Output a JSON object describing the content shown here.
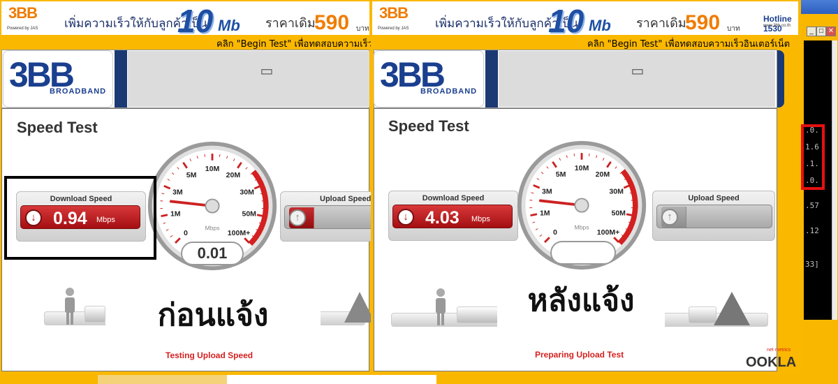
{
  "banner": {
    "brand": "3BB",
    "partner": "Powered by JAS",
    "promo": "เพิ่มความเร็วให้กับลูกค้าเป็น",
    "speed": "10",
    "speed_unit": "Mb",
    "old_price_label": "ราคาเดิม",
    "price": "590",
    "currency": "บาท",
    "hotline": "Hotline 1530",
    "site": "www.3bb.co.th"
  },
  "cta": "คลิก \"Begin Test\" เพื่อทดสอบความเร็วอินเตอร์เน็ต",
  "header": {
    "logo_brand": "3BB",
    "logo_tag": "BROADBAND"
  },
  "panels": [
    {
      "title": "Speed Test",
      "download_label": "Download Speed",
      "download_value": "0.94",
      "download_unit": "Mbps",
      "upload_label": "Upload Speed",
      "gauge_unit": "Mbps",
      "gauge_readout": "0.01",
      "gauge_needle_fraction": 0.19,
      "status": "Testing Upload Speed",
      "caption": "ก่อนแจ้ง"
    },
    {
      "title": "Speed Test",
      "download_label": "Download Speed",
      "download_value": "4.03",
      "download_unit": "Mbps",
      "upload_label": "Upload Speed",
      "gauge_unit": "Mbps",
      "gauge_readout": "",
      "gauge_needle_fraction": 0.19,
      "status": "Preparing Upload Test",
      "caption": "หลังแจ้ง",
      "vendor": "OOKLA",
      "vendor_tag": "net metrics"
    }
  ],
  "gauge_ticks": [
    "0",
    "1M",
    "3M",
    "5M",
    "10M",
    "20M",
    "30M",
    "50M",
    "100M+"
  ],
  "console_lines": [
    ".0.",
    "1.6",
    ".1.",
    ".0.",
    ".57",
    ".12",
    "33]"
  ],
  "window_buttons": [
    "_",
    "□",
    "✕"
  ]
}
